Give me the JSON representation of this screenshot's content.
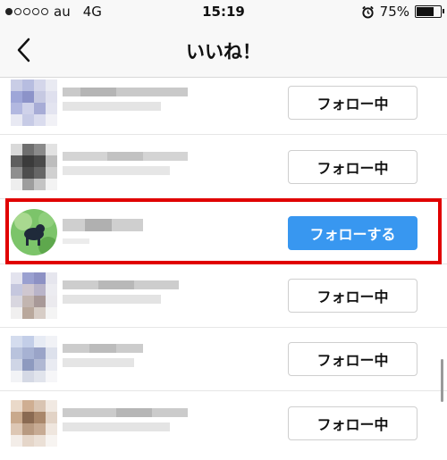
{
  "status_bar": {
    "carrier": "au",
    "network": "4G",
    "time": "15:19",
    "battery": "75%",
    "battery_level": 0.75,
    "signal_bars_filled": 1,
    "signal_bars_total": 5
  },
  "nav": {
    "title": "いいね！",
    "back_icon": "chevron-left-icon"
  },
  "colors": {
    "follow_primary": "#3897f0",
    "highlight_border": "#e00000"
  },
  "rows": [
    {
      "button_label": "フォロー中"
    },
    {
      "button_label": "フォロー中"
    },
    {
      "button_label": "フォローする"
    },
    {
      "button_label": "フォロー中"
    },
    {
      "button_label": "フォロー中"
    },
    {
      "button_label": "フォロー中"
    }
  ]
}
